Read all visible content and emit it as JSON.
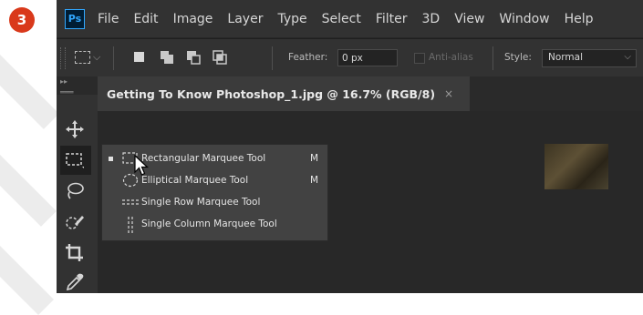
{
  "step_badge": "3",
  "app": {
    "logo_text": "Ps",
    "menu": [
      "File",
      "Edit",
      "Image",
      "Layer",
      "Type",
      "Select",
      "Filter",
      "3D",
      "View",
      "Window",
      "Help"
    ]
  },
  "options": {
    "feather_label": "Feather:",
    "feather_value": "0 px",
    "antialias_label": "Anti-alias",
    "style_label": "Style:",
    "style_value": "Normal"
  },
  "document": {
    "tab_title": "Getting To Know Photoshop_1.jpg @ 16.7% (RGB/8)",
    "close_glyph": "×"
  },
  "flyout": {
    "items": [
      {
        "label": "Rectangular Marquee Tool",
        "shortcut": "M",
        "icon": "rectangular-marquee-icon",
        "selected": true
      },
      {
        "label": "Elliptical Marquee Tool",
        "shortcut": "M",
        "icon": "elliptical-marquee-icon",
        "selected": false
      },
      {
        "label": "Single Row Marquee Tool",
        "shortcut": "",
        "icon": "single-row-marquee-icon",
        "selected": false
      },
      {
        "label": "Single Column Marquee Tool",
        "shortcut": "",
        "icon": "single-column-marquee-icon",
        "selected": false
      }
    ]
  },
  "colors": {
    "badge": "#d9391b",
    "panel": "#323232",
    "canvas": "#282828",
    "flyout": "#424242",
    "ps_blue": "#31a8ff"
  }
}
